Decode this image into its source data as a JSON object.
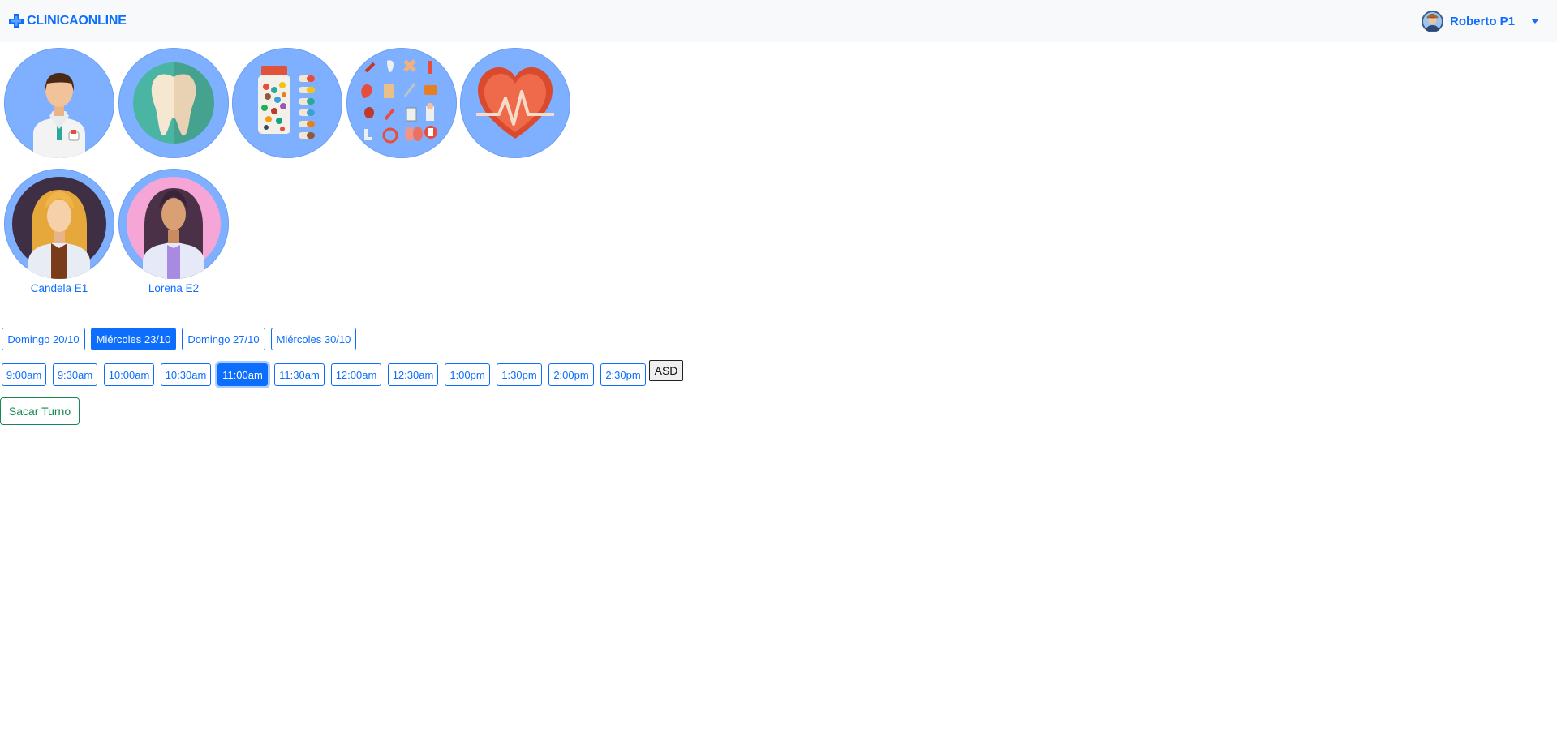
{
  "navbar": {
    "brand": "CLINICAONLINE",
    "user_name": "Roberto P1"
  },
  "colors": {
    "primary": "#0d6efd",
    "success": "#198754",
    "circle_bg": "#7eb0ff",
    "navbar_bg": "#f8f9fa"
  },
  "specialties": [
    {
      "icon": "doctor-icon"
    },
    {
      "icon": "tooth-icon"
    },
    {
      "icon": "pills-icon"
    },
    {
      "icon": "medical-items-icon"
    },
    {
      "icon": "heart-pulse-icon"
    }
  ],
  "professionals": [
    {
      "name": "Candela E1",
      "icon": "woman-doctor-blonde-icon"
    },
    {
      "name": "Lorena E2",
      "icon": "woman-doctor-dark-icon"
    }
  ],
  "days": [
    {
      "label": "Domingo 20/10",
      "selected": false
    },
    {
      "label": "Miércoles 23/10",
      "selected": true
    },
    {
      "label": "Domingo 27/10",
      "selected": false
    },
    {
      "label": "Miércoles 30/10",
      "selected": false
    }
  ],
  "times": [
    {
      "label": "9:00am",
      "selected": false
    },
    {
      "label": "9:30am",
      "selected": false
    },
    {
      "label": "10:00am",
      "selected": false
    },
    {
      "label": "10:30am",
      "selected": false
    },
    {
      "label": "11:00am",
      "selected": true
    },
    {
      "label": "11:30am",
      "selected": false
    },
    {
      "label": "12:00am",
      "selected": false
    },
    {
      "label": "12:30am",
      "selected": false
    },
    {
      "label": "1:00pm",
      "selected": false
    },
    {
      "label": "1:30pm",
      "selected": false
    },
    {
      "label": "2:00pm",
      "selected": false
    },
    {
      "label": "2:30pm",
      "selected": false
    }
  ],
  "asd_label": "ASD",
  "submit_label": "Sacar Turno"
}
